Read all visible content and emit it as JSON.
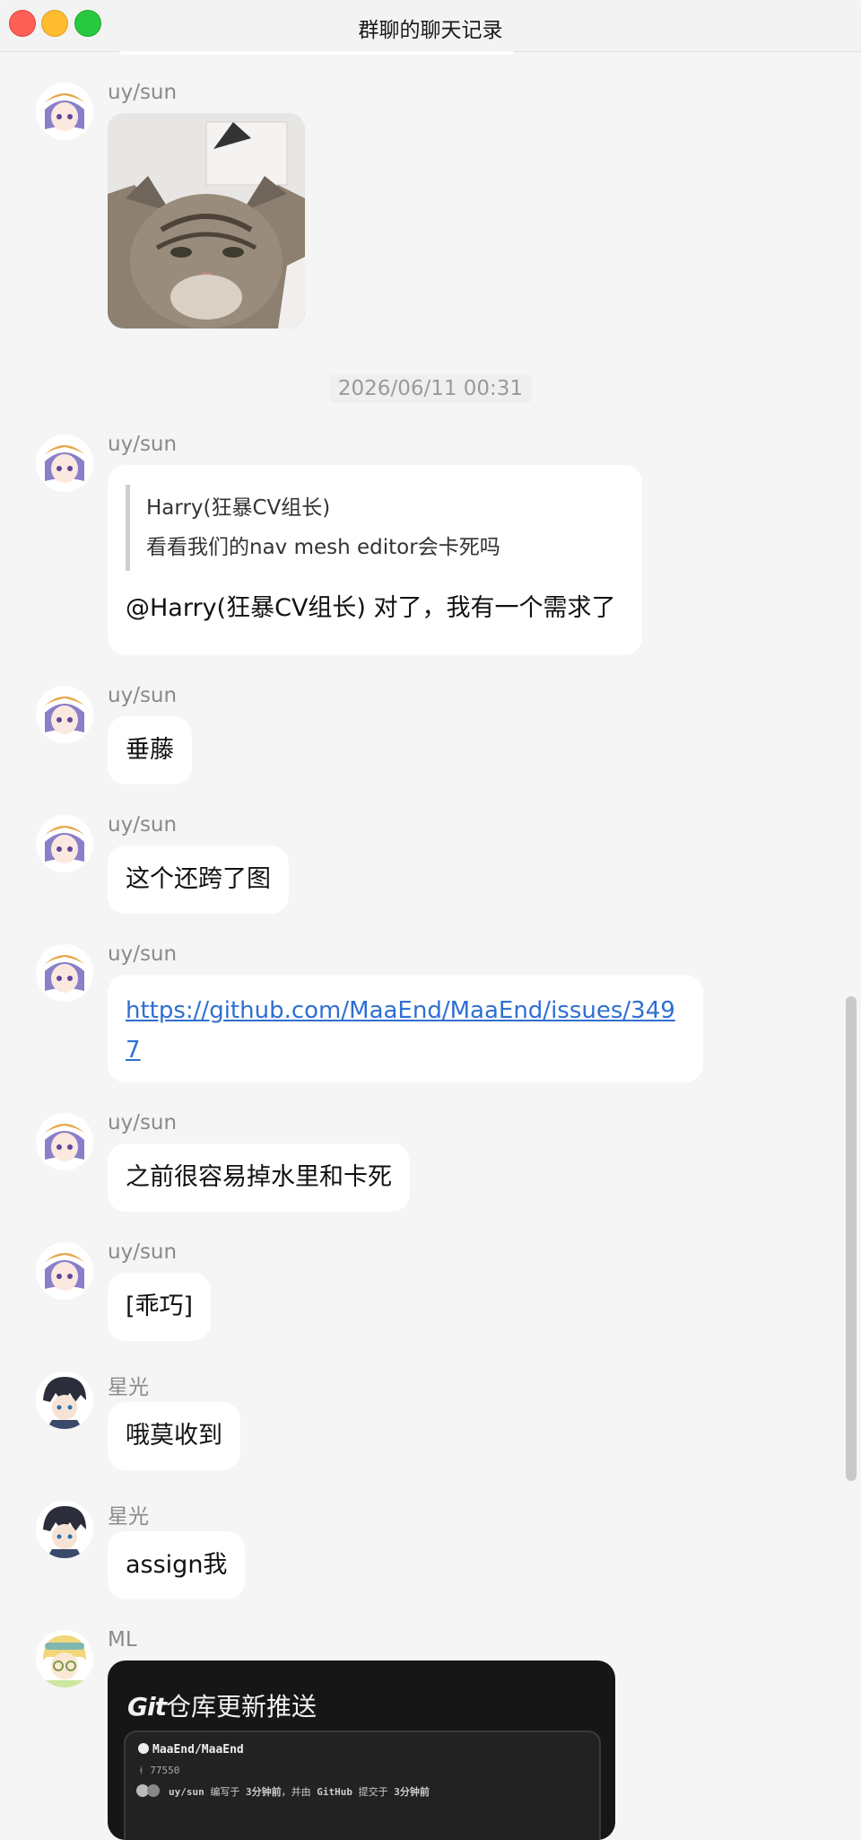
{
  "window": {
    "title": "群聊的聊天记录"
  },
  "timestamp": "2026/06/11 00:31",
  "messages": [
    {
      "sender": "uy/sun",
      "type": "image",
      "image_desc": "cat photo"
    },
    {
      "sender": "uy/sun",
      "type": "quote-reply",
      "quote_author": "Harry(狂暴CV组长)",
      "quote_text": "看看我们的nav mesh editor会卡死吗",
      "text": "@Harry(狂暴CV组长) 对了，我有一个需求了"
    },
    {
      "sender": "uy/sun",
      "type": "text",
      "text": "垂藤"
    },
    {
      "sender": "uy/sun",
      "type": "text",
      "text": "这个还跨了图"
    },
    {
      "sender": "uy/sun",
      "type": "link",
      "text": "https://github.com/MaaEnd/MaaEnd/issues/3497"
    },
    {
      "sender": "uy/sun",
      "type": "text",
      "text": "之前很容易掉水里和卡死"
    },
    {
      "sender": "uy/sun",
      "type": "text",
      "text": "[乖巧]"
    },
    {
      "sender": "星光",
      "type": "text",
      "text": "哦莫收到"
    },
    {
      "sender": "星光",
      "type": "text",
      "text": "assign我"
    },
    {
      "sender": "ML",
      "type": "card",
      "card_title_brand": "Git",
      "card_title_rest": "仓库更新推送",
      "repo": "MaaEnd/MaaEnd",
      "stars": "77550",
      "commit_user": "uy/sun",
      "commit_text_1": "编写于",
      "commit_time_1": "3分钟前",
      "commit_text_2": "，并由",
      "commit_platform": "GitHub",
      "commit_text_3": "提交于",
      "commit_time_2": "3分钟前"
    }
  ],
  "colors": {
    "background": "#f5f5f5",
    "bubble": "#ffffff",
    "link": "#2f6fd1",
    "sender": "#8a8a8a",
    "card": "#161616"
  }
}
